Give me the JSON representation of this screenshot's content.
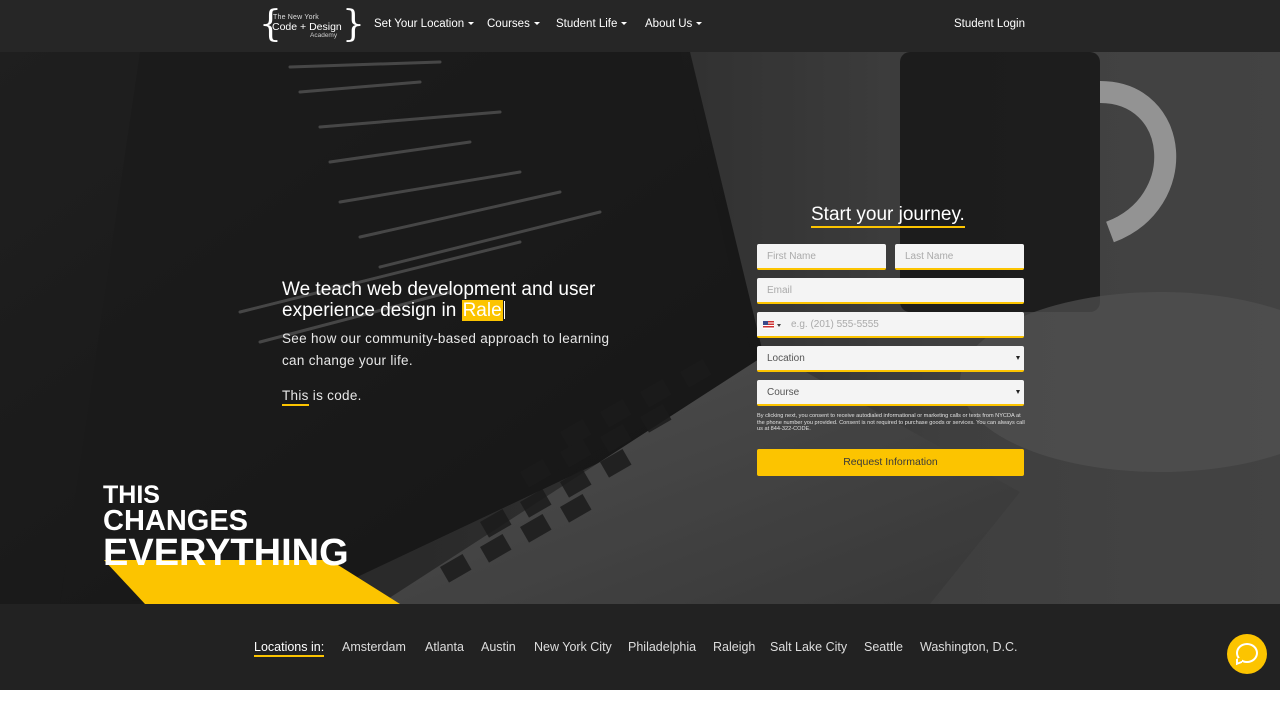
{
  "nav": {
    "logo": {
      "line1": "The New York",
      "line2": "Code + Design",
      "line3": "Academy"
    },
    "items": [
      {
        "label": "Set Your Location"
      },
      {
        "label": "Courses"
      },
      {
        "label": "Student Life"
      },
      {
        "label": "About Us"
      }
    ],
    "login": "Student Login"
  },
  "hero": {
    "headline_prefix": "We teach web development and user experience design in ",
    "headline_typed": "Rale",
    "subline": "See how our community-based approach to learning can change your life.",
    "code_word": "This",
    "code_rest": " is code.",
    "tagline": {
      "line1": "THIS",
      "line2": "CHANGES",
      "line3": "EVERYTHING"
    }
  },
  "form": {
    "title": "Start your journey.",
    "first_name_placeholder": "First Name",
    "last_name_placeholder": "Last Name",
    "email_placeholder": "Email",
    "phone_placeholder": "e.g. (201) 555-5555",
    "location_value": "Location",
    "course_value": "Course",
    "consent": "By clicking next, you consent to receive autodialed informational or marketing calls or texts from NYCDA at the phone number you provided. Consent is not required to purchase goods or services. You can always call us at 844-322-CODE.",
    "submit_label": "Request Information"
  },
  "locations": {
    "label": "Locations in:",
    "cities": [
      "Amsterdam",
      "Atlanta",
      "Austin",
      "New York City",
      "Philadelphia",
      "Raleigh",
      "Salt Lake City",
      "Seattle",
      "Washington, D.C."
    ]
  },
  "colors": {
    "accent": "#fcc400",
    "nav_bg": "#262626",
    "footer_bg": "#222222"
  }
}
